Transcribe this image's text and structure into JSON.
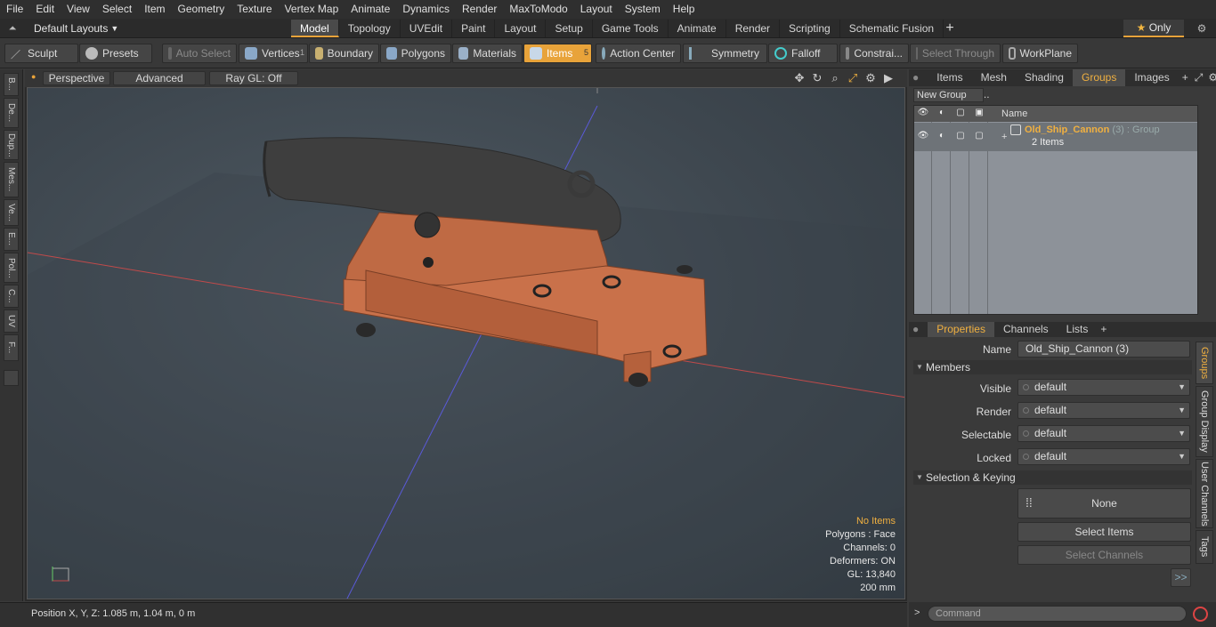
{
  "menubar": {
    "items": [
      "File",
      "Edit",
      "View",
      "Select",
      "Item",
      "Geometry",
      "Texture",
      "Vertex Map",
      "Animate",
      "Dynamics",
      "Render",
      "MaxToModo",
      "Layout",
      "System",
      "Help"
    ]
  },
  "modebar": {
    "layout_label": "Default Layouts",
    "tabs": [
      "Model",
      "Topology",
      "UVEdit",
      "Paint",
      "Layout",
      "Setup",
      "Game Tools",
      "Animate",
      "Render",
      "Scripting",
      "Schematic Fusion"
    ],
    "active_tab": "Model",
    "only_label": "Only"
  },
  "toolbar": {
    "sculpt": "Sculpt",
    "presets": "Presets",
    "auto_select": "Auto Select",
    "vertices": "Vertices",
    "vertices_count": "1",
    "boundary": "Boundary",
    "polygons": "Polygons",
    "materials": "Materials",
    "items": "Items",
    "items_count": "5",
    "action_center": "Action Center",
    "symmetry": "Symmetry",
    "falloff": "Falloff",
    "constraints": "Constrai...",
    "select_through": "Select Through",
    "workplane": "WorkPlane"
  },
  "left_tabs": [
    "B...",
    "De...",
    "Dup...",
    "Mes...",
    "Ve...",
    "E...",
    "Pol...",
    "C...",
    "UV",
    "F..."
  ],
  "viewport": {
    "perspective": "Perspective",
    "advanced": "Advanced",
    "raygl": "Ray GL: Off",
    "info": {
      "no_items": "No Items",
      "polygons": "Polygons : Face",
      "channels": "Channels: 0",
      "deformers": "Deformers: ON",
      "gl": "GL: 13,840",
      "scale": "200 mm"
    }
  },
  "status": {
    "position": "Position X, Y, Z:   1.085 m, 1.04 m, 0 m"
  },
  "right_tabs": [
    "Items",
    "Mesh ...",
    "Shading",
    "Groups",
    "Images"
  ],
  "groups": {
    "new_group": "New Group",
    "col_name": "Name",
    "row": {
      "name": "Old_Ship_Cannon",
      "count": "(3)",
      "type": ": Group",
      "items": "2 Items"
    }
  },
  "properties": {
    "tabs": [
      "Properties",
      "Channels",
      "Lists"
    ],
    "name_label": "Name",
    "name_value": "Old_Ship_Cannon (3)",
    "members": "Members",
    "visible_label": "Visible",
    "render_label": "Render",
    "selectable_label": "Selectable",
    "locked_label": "Locked",
    "default": "default",
    "sel_keying": "Selection & Keying",
    "none": "None",
    "select_items": "Select Items",
    "select_channels": "Select Channels",
    "more": ">>"
  },
  "side_tabs": [
    "Groups",
    "Group Display",
    "User Channels",
    "Tags"
  ],
  "command": {
    "prompt": ">",
    "placeholder": "Command"
  }
}
